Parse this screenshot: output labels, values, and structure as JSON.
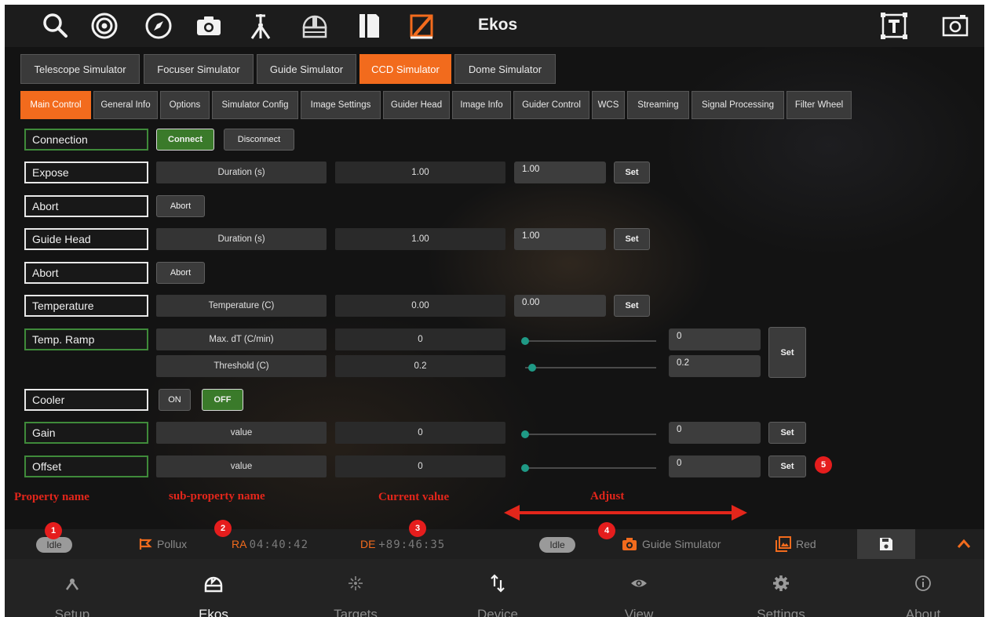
{
  "toolbar": {
    "title": "Ekos",
    "icons": [
      "search-icon",
      "focus-target-icon",
      "compass-icon",
      "camera-icon",
      "mount-icon",
      "dome-icon",
      "flat-box-icon",
      "align-icon",
      "text-overlay-icon",
      "screenshot-icon"
    ]
  },
  "device_tabs": [
    "Telescope Simulator",
    "Focuser Simulator",
    "Guide Simulator",
    "CCD Simulator",
    "Dome Simulator"
  ],
  "active_device_tab": "CCD Simulator",
  "property_tabs": [
    "Main Control",
    "General Info",
    "Options",
    "Simulator Config",
    "Image Settings",
    "Guider Head",
    "Image Info",
    "Guider Control",
    "WCS",
    "Streaming",
    "Signal Processing",
    "Filter Wheel"
  ],
  "active_property_tab": "Main Control",
  "properties": {
    "connection": {
      "name": "Connection",
      "connect": "Connect",
      "disconnect": "Disconnect"
    },
    "expose": {
      "name": "Expose",
      "sub": "Duration (s)",
      "current": "1.00",
      "input": "1.00",
      "set": "Set"
    },
    "abort1": {
      "name": "Abort",
      "button": "Abort"
    },
    "guide_head": {
      "name": "Guide Head",
      "sub": "Duration (s)",
      "current": "1.00",
      "input": "1.00",
      "set": "Set"
    },
    "abort2": {
      "name": "Abort",
      "button": "Abort"
    },
    "temperature": {
      "name": "Temperature",
      "sub": "Temperature (C)",
      "current": "0.00",
      "input": "0.00",
      "set": "Set"
    },
    "temp_ramp": {
      "name": "Temp. Ramp",
      "sub1": "Max. dT (C/min)",
      "current1": "0",
      "input1": "0",
      "sub2": "Threshold (C)",
      "current2": "0.2",
      "input2": "0.2",
      "set": "Set"
    },
    "cooler": {
      "name": "Cooler",
      "on": "ON",
      "off": "OFF"
    },
    "gain": {
      "name": "Gain",
      "sub": "value",
      "current": "0",
      "input": "0",
      "set": "Set"
    },
    "offset": {
      "name": "Offset",
      "sub": "value",
      "current": "0",
      "input": "0",
      "set": "Set"
    }
  },
  "annotations": {
    "property_name": "Property name",
    "subproperty_name": "sub-property name",
    "current_value": "Current value",
    "adjust": "Adjust",
    "badges": [
      "1",
      "2",
      "3",
      "4",
      "5"
    ]
  },
  "status": {
    "mount_state": "Idle",
    "target": "Pollux",
    "ra_label": "RA",
    "ra_value": "04:40:42",
    "de_label": "DE",
    "de_value": "+89:46:35",
    "camera_state": "Idle",
    "camera": "Guide Simulator",
    "filter": "Red"
  },
  "nav": {
    "items": [
      "Setup",
      "Ekos",
      "Targets",
      "Device",
      "View",
      "Settings",
      "About"
    ],
    "active": "Ekos"
  },
  "colors": {
    "accent": "#f26b1d",
    "connected_border": "#3f8a3a",
    "slider": "#1f9a86",
    "annotation": "#e3261b"
  }
}
